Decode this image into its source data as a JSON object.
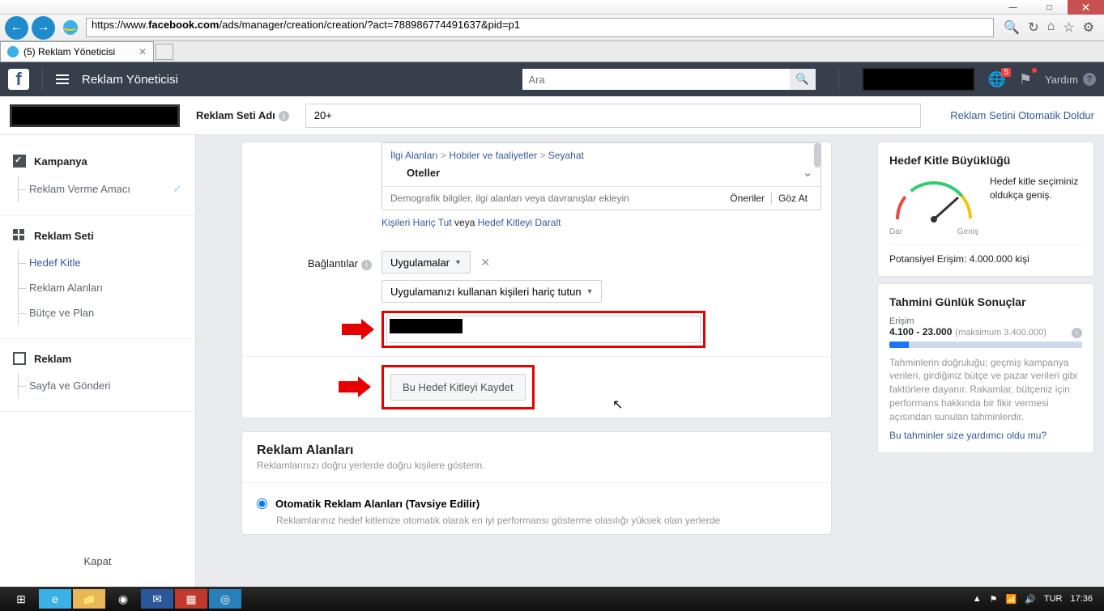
{
  "browser": {
    "url_prefix": "https://www.",
    "url_domain": "facebook.com",
    "url_path": "/ads/manager/creation/creation/?act=788986774491637&pid=p1",
    "tab_title": "(5) Reklam Yöneticisi",
    "win_min": "—",
    "win_max": "□",
    "win_close": "✕"
  },
  "header": {
    "title": "Reklam Yöneticisi",
    "search_placeholder": "Ara",
    "notif_count": "5",
    "help": "Yardım"
  },
  "subheader": {
    "label": "Reklam Seti Adı",
    "value": "20+",
    "auto_fill": "Reklam Setini Otomatik Doldur"
  },
  "nav": {
    "campaign": "Kampanya",
    "campaign_sub": "Reklam Verme Amacı",
    "adset": "Reklam Seti",
    "adset_items": [
      "Hedef Kitle",
      "Reklam Alanları",
      "Bütçe ve Plan"
    ],
    "ad": "Reklam",
    "ad_sub": "Sayfa ve Gönderi",
    "close": "Kapat"
  },
  "targeting": {
    "crumb1": "İlgi Alanları",
    "crumb2": "Hobiler ve faaliyetler",
    "crumb3": "Seyahat",
    "tag": "Oteller",
    "placeholder": "Demografik bilgiler, ilgi alanları veya davranışlar ekleyin",
    "suggestions": "Öneriler",
    "browse": "Göz At",
    "exclude": "Kişileri Hariç Tut",
    "or": "veya",
    "narrow": "Hedef Kitleyi Daralt"
  },
  "connections": {
    "label": "Bağlantılar",
    "type": "Uygulamalar",
    "option": "Uygulamanızı kullanan kişileri hariç tutun",
    "save_btn": "Bu Hedef Kitleyi Kaydet"
  },
  "placements": {
    "title": "Reklam Alanları",
    "subtitle": "Reklamlarınızı doğru yerlerde doğru kişilere gösterin.",
    "auto_label": "Otomatik Reklam Alanları (Tavsiye Edilir)",
    "auto_desc": "Reklamlarınız hedef kitlenize otomatik olarak en iyi performansı gösterme olasılığı yüksek olan yerlerde"
  },
  "right": {
    "size_title": "Hedef Kitle Büyüklüğü",
    "size_text": "Hedef kitle seçiminiz oldukça geniş.",
    "gauge_low": "Dar",
    "gauge_high": "Geniş",
    "reach_label": "Potansiyel Erişim: 4.000.000 kişi",
    "est_title": "Tahmini Günlük Sonuçlar",
    "est_sub": "Erişim",
    "est_range": "4.100 - 23.000",
    "est_max": "(maksimum 3.400.000)",
    "est_desc": "Tahminlerin doğruluğu; geçmiş kampanya verileri, girdiğiniz bütçe ve pazar verileri gibi faktörlere dayanır. Rakamlar, bütçeniz için performans hakkında bir fikir vermesi açısından sunulan tahminlerdir.",
    "est_q": "Bu tahminler size yardımcı oldu mu?"
  },
  "taskbar": {
    "lang": "TUR",
    "time": "17:36"
  }
}
